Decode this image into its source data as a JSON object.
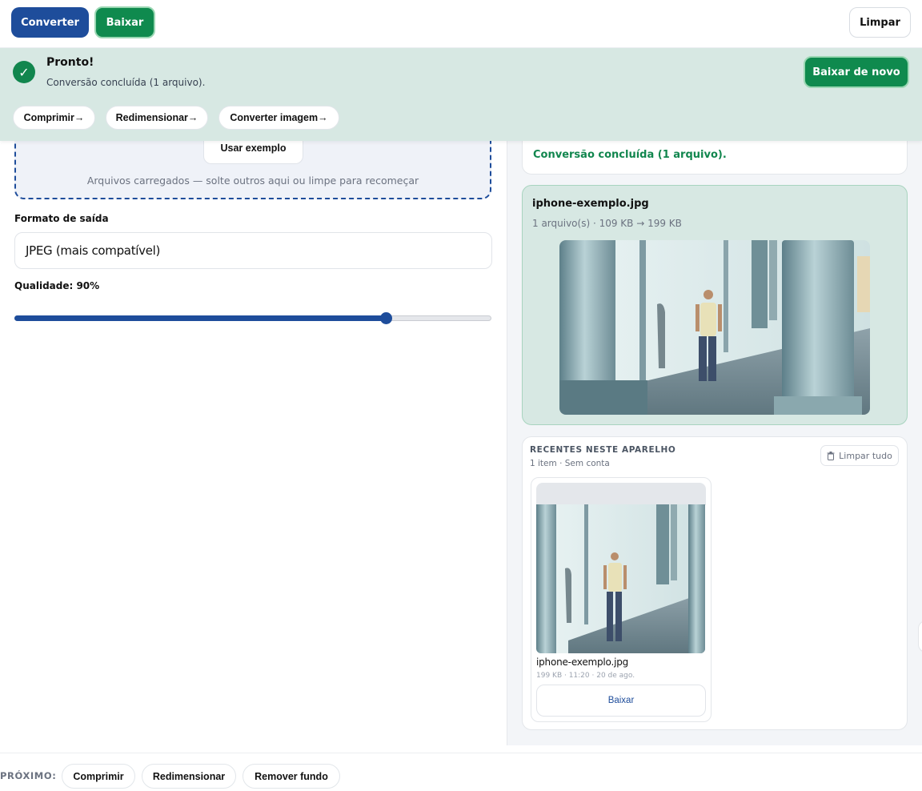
{
  "toolbar": {
    "convert_label": "Converter",
    "download_label": "Baixar",
    "clear_label": "Limpar"
  },
  "banner": {
    "check_icon": "✓",
    "title": "Pronto!",
    "subtitle": "Conversão concluída (1 arquivo).",
    "download_again_label": "Baixar de novo",
    "next_actions": [
      "Comprimir→",
      "Redimensionar→",
      "Converter imagem→"
    ]
  },
  "upload": {
    "example_button": "Usar exemplo",
    "hint": "Arquivos carregados — solte outros aqui ou limpe para recomeçar"
  },
  "settings": {
    "format_label": "Formato de saída",
    "format_value": "JPEG (mais compatível)",
    "quality_label": "Qualidade: 90%",
    "quality_level": 0.78
  },
  "status": {
    "message": "Conversão concluída (1 arquivo)."
  },
  "result": {
    "file_name": "iphone-exemplo.jpg",
    "meta": "1 arquivo(s) · 109 KB → 199 KB"
  },
  "recent": {
    "title": "RECENTES NESTE APARELHO",
    "subtitle": "1 item · Sem conta",
    "clear_all_label": "Limpar tudo",
    "items": [
      {
        "name": "iphone-exemplo.jpg",
        "meta": "199 KB · 11:20 · 20 de ago.",
        "download_label": "Baixar"
      }
    ]
  },
  "bottom": {
    "next_label": "PRÓXIMO:",
    "actions": [
      "Comprimir",
      "Redimensionar",
      "Remover fundo"
    ]
  },
  "colors": {
    "primary": "#1e4d9b",
    "success": "#0f8a4e",
    "banner_bg": "#d7e8e3"
  }
}
